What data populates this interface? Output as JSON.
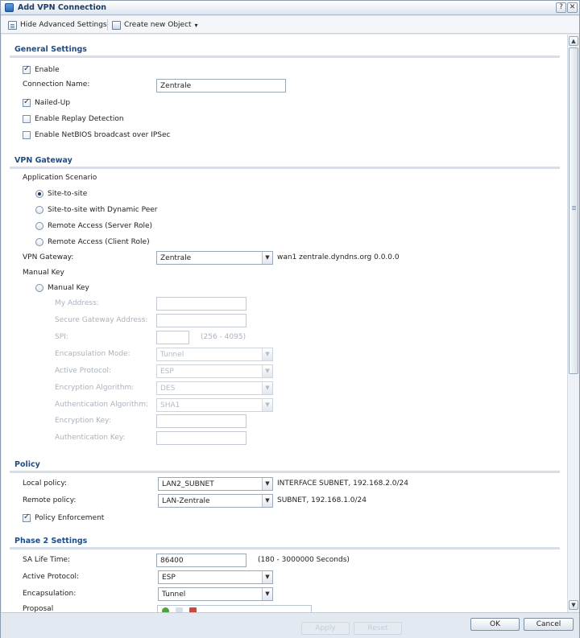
{
  "window": {
    "title": "Add VPN Connection",
    "help_btn": "?",
    "close_btn": "✕"
  },
  "toolbar": {
    "hide_advanced": "Hide Advanced Settings",
    "create_new": "Create new Object",
    "create_arrow": "▾"
  },
  "general": {
    "title": "General Settings",
    "enable_label": "Enable",
    "enable_checked": true,
    "conn_name_label": "Connection Name:",
    "conn_name_value": "Zentrale",
    "nailed_up_label": "Nailed-Up",
    "nailed_up_checked": true,
    "replay_label": "Enable Replay Detection",
    "netbios_label": "Enable NetBIOS broadcast over IPSec"
  },
  "gateway": {
    "title": "VPN Gateway",
    "app_scenario_label": "Application Scenario",
    "options": [
      "Site-to-site",
      "Site-to-site with Dynamic Peer",
      "Remote Access (Server Role)",
      "Remote Access (Client Role)"
    ],
    "selected_index": 0,
    "vpn_gateway_label": "VPN Gateway:",
    "vpn_gateway_value": "Zentrale",
    "vpn_gateway_info": "wan1 zentrale.dyndns.org 0.0.0.0",
    "manual_key_heading": "Manual Key",
    "manual_key_radio": "Manual Key",
    "my_address": "My Address:",
    "secure_gw": "Secure Gateway Address:",
    "spi": "SPI:",
    "spi_range": "(256 - 4095)",
    "encap_mode": "Encapsulation Mode:",
    "encap_mode_value": "Tunnel",
    "active_proto": "Active Protocol:",
    "active_proto_value": "ESP",
    "enc_alg": "Encryption Algorithm:",
    "enc_alg_value": "DES",
    "auth_alg": "Authentication Algorithm:",
    "auth_alg_value": "SHA1",
    "enc_key": "Encryption Key:",
    "auth_key": "Authentication Key:"
  },
  "policy": {
    "title": "Policy",
    "local_label": "Local policy:",
    "local_value": "LAN2_SUBNET",
    "local_info": "INTERFACE SUBNET, 192.168.2.0/24",
    "remote_label": "Remote policy:",
    "remote_value": "LAN-Zentrale",
    "remote_info": "SUBNET, 192.168.1.0/24",
    "enforcement_label": "Policy Enforcement",
    "enforcement_checked": true
  },
  "phase2": {
    "title": "Phase 2 Settings",
    "sa_life_label": "SA Life Time:",
    "sa_life_value": "86400",
    "sa_life_range": "(180 - 3000000 Seconds)",
    "active_proto_label": "Active Protocol:",
    "active_proto_value": "ESP",
    "encap_label": "Encapsulation:",
    "encap_value": "Tunnel",
    "proposal_label": "Proposal"
  },
  "footer": {
    "apply": "Apply",
    "reset": "Reset",
    "ok": "OK",
    "cancel": "Cancel"
  },
  "colors": {
    "section_title": "#1f4d85",
    "title_text": "#1d3c66"
  }
}
